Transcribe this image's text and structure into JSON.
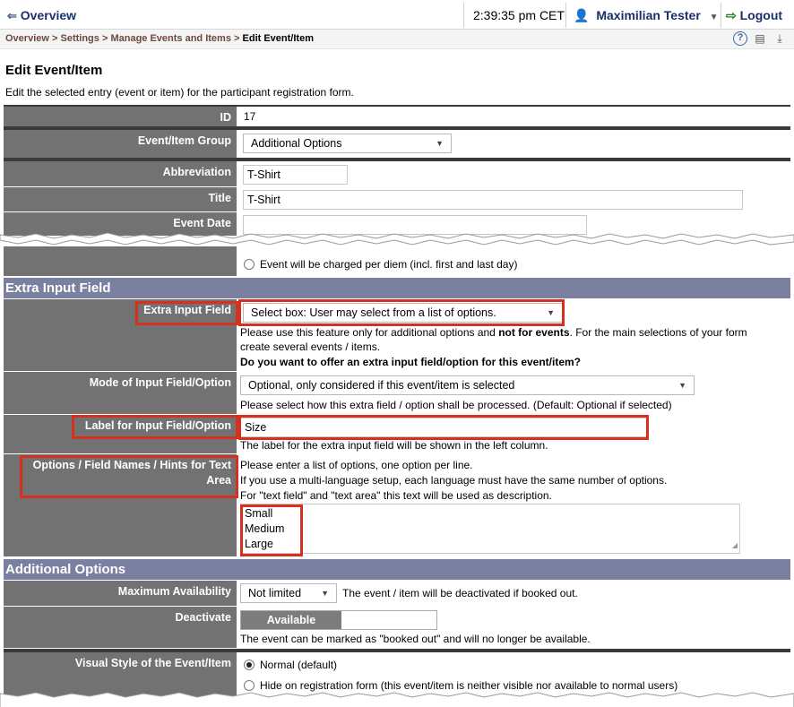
{
  "topbar": {
    "overview_label": "Overview",
    "time": "2:39:35 pm CET",
    "user": "Maximilian Tester",
    "logout_label": "Logout"
  },
  "breadcrumb": {
    "items": [
      "Overview",
      "Settings",
      "Manage Events and Items"
    ],
    "separator": ">",
    "current": "Edit Event/Item"
  },
  "page": {
    "title": "Edit Event/Item",
    "description": "Edit the selected entry (event or item) for the participant registration form."
  },
  "form": {
    "id_label": "ID",
    "id_value": "17",
    "group_label": "Event/Item Group",
    "group_value": "Additional Options",
    "abbr_label": "Abbreviation",
    "abbr_value": "T-Shirt",
    "title_label": "Title",
    "title_value": "T-Shirt",
    "date_label": "Event Date",
    "date_value": "",
    "perdiem_option": "Event will be charged per diem (incl. first and last day)"
  },
  "extra_section": {
    "title": "Extra Input Field",
    "field_label": "Extra Input Field",
    "field_value": "Select box: User may select from a list of options.",
    "help_1": "Please use this feature only for additional options and ",
    "help_bold": "not for events",
    "help_2": ". For the main selections of your form create several events / items.",
    "question": "Do you want to offer an extra input field/option for this event/item?",
    "mode_label": "Mode of Input Field/Option",
    "mode_value": "Optional, only considered if this event/item is selected",
    "mode_help": "Please select how this extra field / option shall be processed. (Default: Optional if selected)",
    "label_label": "Label for Input Field/Option",
    "label_value": "Size",
    "label_help": "The label for the extra input field will be shown in the left column.",
    "options_label": "Options / Field Names / Hints for Text Area",
    "options_help_1": "Please enter a list of options, one option per line.",
    "options_help_2": "If you use a multi-language setup, each language must have the same number of options.",
    "options_help_3": "For \"text field\" and \"text area\" this text will be used as description.",
    "options": [
      "Small",
      "Medium",
      "Large"
    ]
  },
  "additional_section": {
    "title": "Additional Options",
    "max_label": "Maximum Availability",
    "max_value": "Not limited",
    "max_help": "The event / item will be deactivated if booked out.",
    "deactivate_label": "Deactivate",
    "deactivate_value": "Available",
    "deactivate_help": "The event can be marked as \"booked out\" and will no longer be available.",
    "visual_label": "Visual Style of the Event/Item",
    "visual_opt_1": "Normal (default)",
    "visual_opt_2": "Hide on registration form (this event/item is neither visible nor available to normal users)"
  },
  "colors": {
    "label_bg": "#727272",
    "section_bg": "#7a80a0",
    "highlight": "#d6301e",
    "link": "#1a2f6b"
  }
}
